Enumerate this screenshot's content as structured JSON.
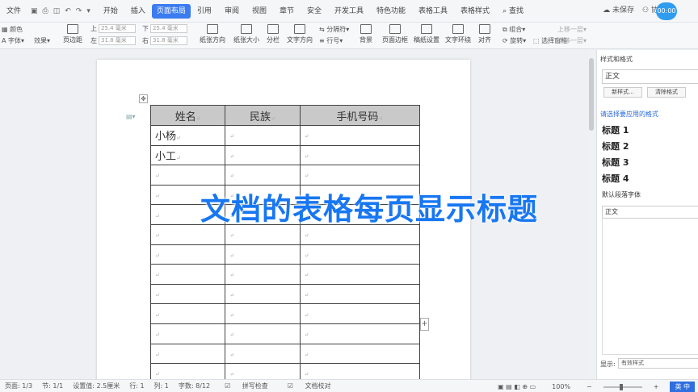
{
  "menubar": {
    "file": "文件",
    "items": [
      "开始",
      "插入",
      "页面布局",
      "引用",
      "审阅",
      "视图",
      "章节",
      "安全",
      "开发工具",
      "特色功能",
      "表格工具",
      "表格样式"
    ],
    "active": "页面布局",
    "search": "查找",
    "unsaved": "未保存",
    "collab": "协作",
    "avatar": "00:00"
  },
  "ribbon": {
    "color": "颜色",
    "font": "字体",
    "effect": "效果",
    "margins": "页边距",
    "top_label": "上",
    "top_val": "25.4 毫米",
    "bottom_label": "下",
    "bottom_val": "25.4 毫米",
    "left_label": "左",
    "left_val": "31.8 毫米",
    "right_label": "右",
    "right_val": "31.8 毫米",
    "orientation": "纸张方向",
    "size": "纸张大小",
    "columns": "分栏",
    "text_dir": "文字方向",
    "break": "分隔符",
    "line_no": "行号",
    "background": "背景",
    "border": "页面边框",
    "grid": "稿纸设置",
    "wrap": "文字环绕",
    "align": "对齐",
    "rotate": "旋转",
    "up": "上移一层",
    "down": "下移一层",
    "select": "选择窗格",
    "group": "组合"
  },
  "table": {
    "headers": [
      "姓名",
      "民族",
      "手机号码"
    ],
    "rows": [
      [
        "小杨",
        "",
        ""
      ],
      [
        "小工",
        "",
        ""
      ],
      [
        "",
        "",
        ""
      ],
      [
        "",
        "",
        ""
      ],
      [
        "",
        "",
        ""
      ],
      [
        "",
        "",
        ""
      ],
      [
        "",
        "",
        ""
      ],
      [
        "",
        "",
        ""
      ],
      [
        "",
        "",
        ""
      ],
      [
        "",
        "",
        ""
      ],
      [
        "",
        "",
        ""
      ],
      [
        "",
        "",
        ""
      ],
      [
        "",
        "",
        ""
      ]
    ]
  },
  "overlay": "文档的表格每页显示标题",
  "panel": {
    "title": "样式和格式",
    "current": "正文",
    "new_style": "新样式...",
    "clear": "清除格式",
    "hint": "请选择要应用的格式",
    "styles": [
      "标题 1",
      "标题 2",
      "标题 3",
      "标题 4"
    ],
    "default_font": "默认段落字体",
    "body": "正文",
    "show_label": "显示:",
    "show_value": "有效样式"
  },
  "statusbar": {
    "page": "页面: 1/3",
    "section": "节: 1/1",
    "setting": "设置值: 2.5厘米",
    "row": "行: 1",
    "col": "列: 1",
    "words": "字数: 8/12",
    "spell": "拼写检查",
    "proof": "文档校对",
    "zoom": "100%",
    "ime": "英 中"
  }
}
